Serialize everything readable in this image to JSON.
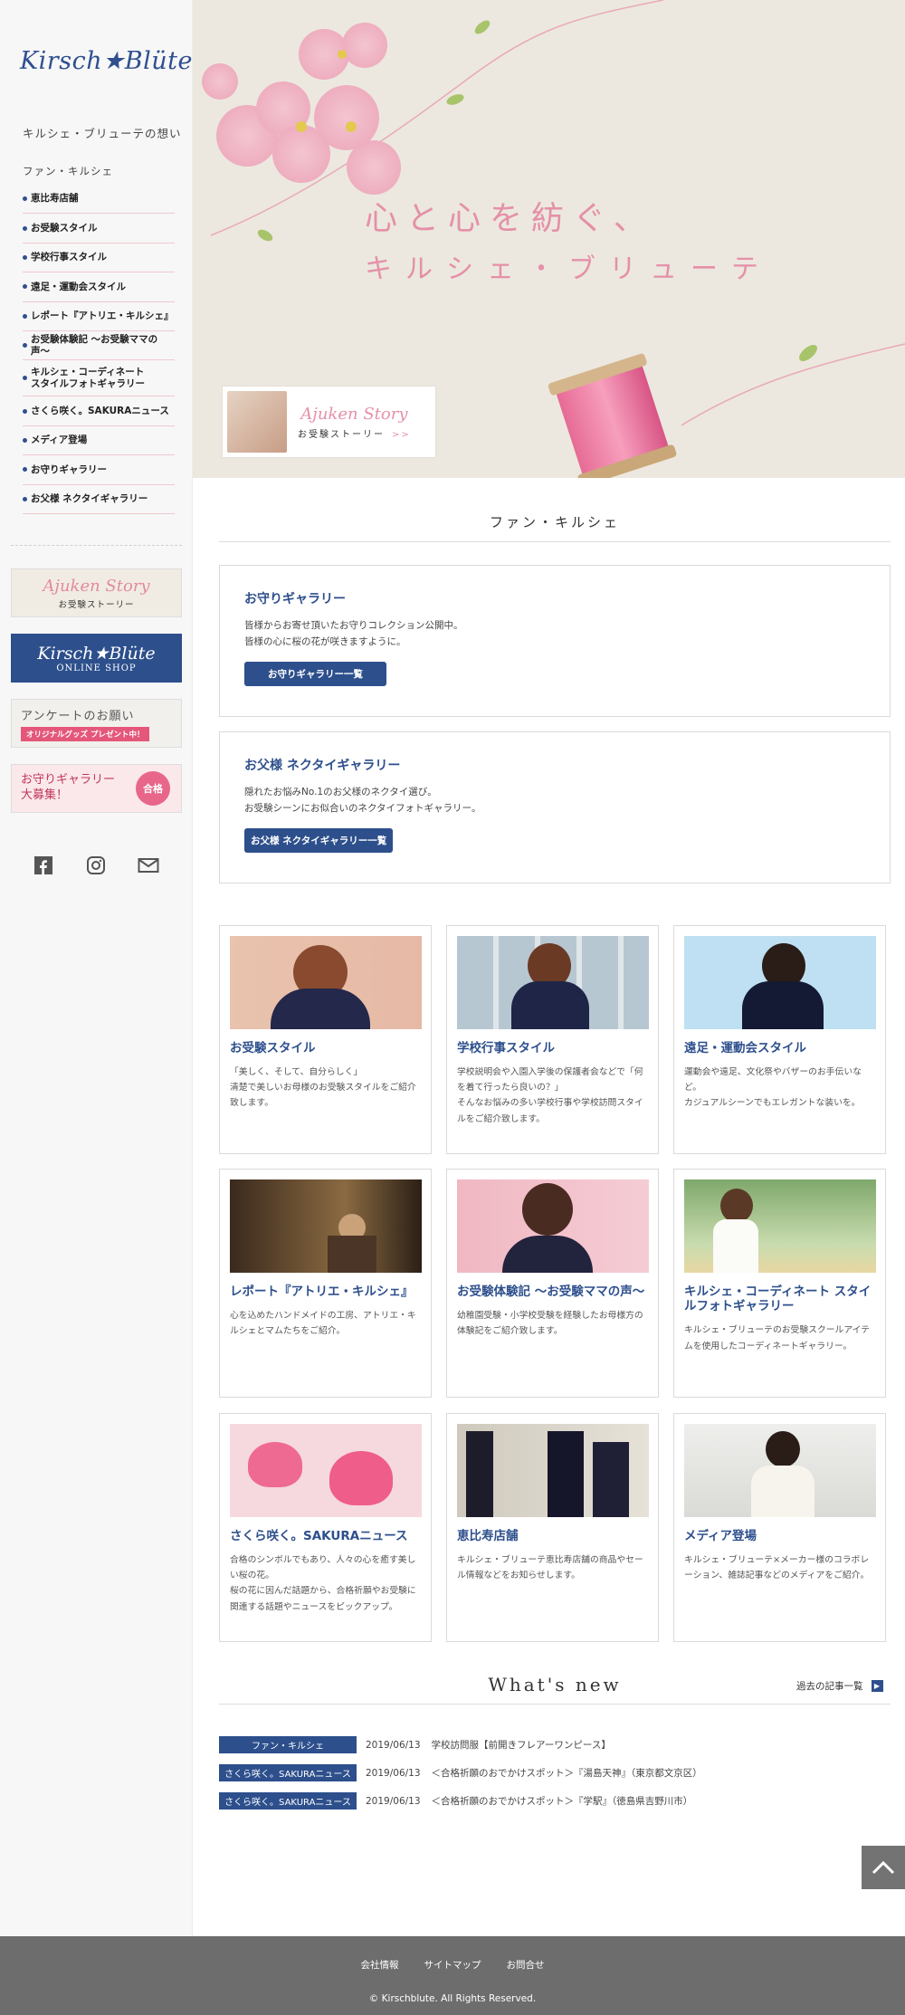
{
  "sidebar": {
    "logo": "Kirsch★Blüte",
    "about": "キルシェ・ブリューテの想い",
    "fan": "ファン・キルシェ",
    "menu": [
      "恵比寿店舗",
      "お受験スタイル",
      "学校行事スタイル",
      "遠足・運動会スタイル",
      "レポート『アトリエ・キルシェ』",
      "お受験体験記 〜お受験ママの声〜",
      "キルシェ・コーディネート\nスタイルフォトギャラリー",
      "さくら咲く。SAKURAニュース",
      "メディア登場",
      "お守りギャラリー",
      "お父様 ネクタイギャラリー"
    ],
    "banners": {
      "ajuken_title": "Ajuken Story",
      "ajuken_sub": "お受験ストーリー",
      "shop_title": "Kirsch★Blüte",
      "shop_sub": "ONLINE SHOP",
      "survey_title": "アンケートのお願い",
      "survey_sub": "オリジナルグッズ プレゼント中！",
      "omamori_title": "お守りギャラリー\n大募集！",
      "omamori_stamp": "合格"
    },
    "social_icons": [
      "facebook-icon",
      "instagram-icon",
      "mail-icon"
    ]
  },
  "hero": {
    "title_line1": "心と心を紡ぐ、",
    "title_line2": "キルシェ・ブリューテ",
    "story_title": "Ajuken Story",
    "story_sub": "お受験ストーリー",
    "story_arrow": ">>"
  },
  "main": {
    "section_heading": "ファン・キルシェ",
    "boxes": [
      {
        "title": "お守りギャラリー",
        "line1": "皆様からお寄せ頂いたお守りコレクション公開中。",
        "line2": "皆様の心に桜の花が咲きますように。",
        "button": "お守りギャラリー一覧"
      },
      {
        "title": "お父様 ネクタイギャラリー",
        "line1": "隠れたお悩みNo.1のお父様のネクタイ選び。",
        "line2": "お受験シーンにお似合いのネクタイフォトギャラリー。",
        "button": "お父様 ネクタイギャラリー一覧"
      }
    ],
    "cards": [
      {
        "title": "お受験スタイル",
        "text": "「美しく、そして、自分らしく」\n清楚で美しいお母様のお受験スタイルをご紹介致します。"
      },
      {
        "title": "学校行事スタイル",
        "text": "学校説明会や入園入学後の保護者会などで「何を着て行ったら良いの？」\nそんなお悩みの多い学校行事や学校訪問スタイルをご紹介致します。"
      },
      {
        "title": "遠足・運動会スタイル",
        "text": "運動会や遠足、文化祭やバザーのお手伝いなど。\nカジュアルシーンでもエレガントな装いを。"
      },
      {
        "title": "レポート『アトリエ・キルシェ』",
        "text": "心を込めたハンドメイドの工房、アトリエ・キルシェとマムたちをご紹介。"
      },
      {
        "title": "お受験体験記 〜お受験ママの声〜",
        "text": "幼稚園受験・小学校受験を経験したお母様方の体験記をご紹介致します。"
      },
      {
        "title": "キルシェ・コーディネート スタイルフォトギャラリー",
        "text": "キルシェ・ブリューテのお受験スクールアイテムを使用したコーディネートギャラリー。"
      },
      {
        "title": "さくら咲く。SAKURAニュース",
        "text": "合格のシンボルでもあり、人々の心を癒す美しい桜の花。\n桜の花に因んだ話題から、合格祈願やお受験に関連する話題やニュースをピックアップ。"
      },
      {
        "title": "恵比寿店舗",
        "text": "キルシェ・ブリューテ恵比寿店舗の商品やセール情報などをお知らせします。"
      },
      {
        "title": "メディア登場",
        "text": "キルシェ・ブリューテ×メーカー様のコラボレーション、雑誌記事などのメディアをご紹介。"
      }
    ]
  },
  "news": {
    "heading": "What's new",
    "past_link": "過去の記事一覧",
    "items": [
      {
        "category": "ファン・キルシェ",
        "date": "2019/06/13",
        "text": "学校訪問服【前開きフレアーワンピース】"
      },
      {
        "category": "さくら咲く。SAKURAニュース",
        "date": "2019/06/13",
        "text": "＜合格祈願のおでかけスポット＞『湯島天神』（東京都文京区）"
      },
      {
        "category": "さくら咲く。SAKURAニュース",
        "date": "2019/06/13",
        "text": "＜合格祈願のおでかけスポット＞『学駅』（徳島県吉野川市）"
      }
    ]
  },
  "footer": {
    "links": [
      "会社情報",
      "サイトマップ",
      "お問合せ"
    ],
    "copyright": "© Kirschblute. All Rights Reserved."
  },
  "colors": {
    "brand_navy": "#2d4f8c",
    "accent_pink": "#e590a8",
    "footer_gray": "#6d6d6d"
  }
}
